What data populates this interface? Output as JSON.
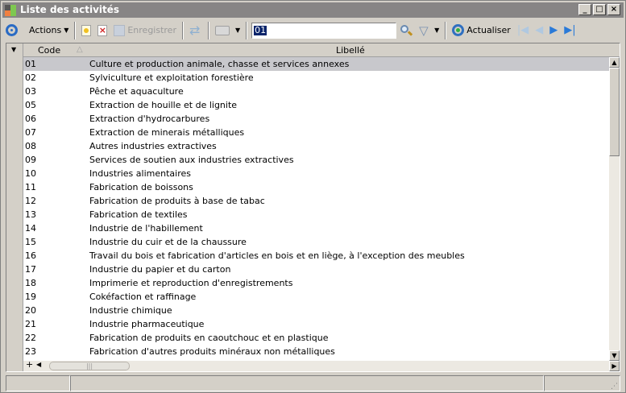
{
  "window": {
    "title": "Liste des activités"
  },
  "toolbar": {
    "actions_label": "Actions",
    "save_label": "Enregistrer",
    "search_value": "01",
    "refresh_label": "Actualiser"
  },
  "grid": {
    "columns": {
      "code": "Code",
      "label": "Libellé"
    },
    "rows": [
      {
        "code": "01",
        "label": "Culture et production animale, chasse et services annexes"
      },
      {
        "code": "02",
        "label": "Sylviculture et exploitation forestière"
      },
      {
        "code": "03",
        "label": "Pêche et aquaculture"
      },
      {
        "code": "05",
        "label": "Extraction de houille et de lignite"
      },
      {
        "code": "06",
        "label": "Extraction d'hydrocarbures"
      },
      {
        "code": "07",
        "label": "Extraction de minerais métalliques"
      },
      {
        "code": "08",
        "label": "Autres industries extractives"
      },
      {
        "code": "09",
        "label": "Services de soutien aux industries extractives"
      },
      {
        "code": "10",
        "label": "Industries alimentaires"
      },
      {
        "code": "11",
        "label": "Fabrication de boissons"
      },
      {
        "code": "12",
        "label": "Fabrication de produits à base de tabac"
      },
      {
        "code": "13",
        "label": "Fabrication de textiles"
      },
      {
        "code": "14",
        "label": "Industrie de l'habillement"
      },
      {
        "code": "15",
        "label": "Industrie du cuir et de la chaussure"
      },
      {
        "code": "16",
        "label": "Travail du bois et fabrication d'articles en bois et en liège, à l'exception des meubles"
      },
      {
        "code": "17",
        "label": "Industrie du papier et du carton"
      },
      {
        "code": "18",
        "label": "Imprimerie et reproduction d'enregistrements"
      },
      {
        "code": "19",
        "label": "Cokéfaction et raffinage"
      },
      {
        "code": "20",
        "label": "Industrie chimique"
      },
      {
        "code": "21",
        "label": "Industrie pharmaceutique"
      },
      {
        "code": "22",
        "label": "Fabrication de produits en caoutchouc et en plastique"
      },
      {
        "code": "23",
        "label": "Fabrication d'autres produits minéraux non métalliques"
      }
    ],
    "selected_row": 0
  },
  "footer": {
    "add_symbol": "+"
  }
}
